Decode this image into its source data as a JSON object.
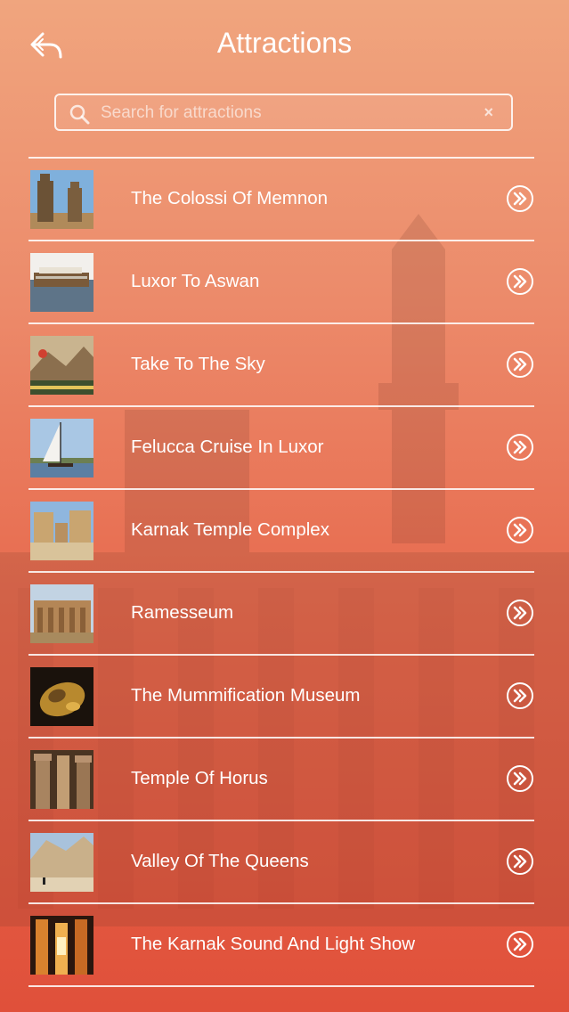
{
  "header": {
    "title": "Attractions",
    "back_icon": "back-arrow-icon"
  },
  "search": {
    "placeholder": "Search for attractions",
    "value": "",
    "clear_label": "×"
  },
  "colors": {
    "accent": "#ffffff",
    "bg_top": "#f0a57e",
    "bg_bottom": "#e0503a"
  },
  "attractions": [
    {
      "label": "The Colossi Of Memnon",
      "thumb": "colossi-photo"
    },
    {
      "label": "Luxor To Aswan",
      "thumb": "cruise-boat-photo"
    },
    {
      "label": "Take To The Sky",
      "thumb": "balloon-photo"
    },
    {
      "label": "Felucca Cruise In Luxor",
      "thumb": "felucca-photo"
    },
    {
      "label": "Karnak Temple Complex",
      "thumb": "karnak-photo"
    },
    {
      "label": "Ramesseum",
      "thumb": "ramesseum-photo"
    },
    {
      "label": "The Mummification Museum",
      "thumb": "mask-photo"
    },
    {
      "label": "Temple Of Horus",
      "thumb": "horus-columns-photo"
    },
    {
      "label": "Valley Of The Queens",
      "thumb": "valley-photo"
    },
    {
      "label": "The Karnak Sound And Light Show",
      "thumb": "light-show-photo"
    }
  ]
}
